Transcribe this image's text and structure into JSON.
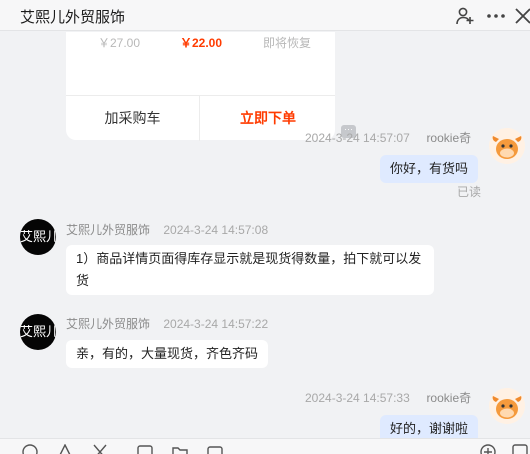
{
  "header": {
    "title": "艾熙儿外贸服饰"
  },
  "product_card": {
    "original_price": "￥27.00",
    "price": "￥22.00",
    "note": "即将恢复",
    "add_to_cart": "加采购车",
    "buy_now": "立即下单",
    "more_label": "···"
  },
  "messages": [
    {
      "time": "2024-3-24 14:57:07",
      "sender": "rookie奇",
      "text": "你好，有货吗",
      "status": "已读"
    },
    {
      "sender": "艾熙儿外贸服饰",
      "time": "2024-3-24 14:57:08",
      "text": "1）商品详情页面得库存显示就是现货得数量，拍下就可以发货",
      "avatar_text": "艾熙儿"
    },
    {
      "sender": "艾熙儿外贸服饰",
      "time": "2024-3-24 14:57:22",
      "text": "亲，有的，大量现货，齐色齐码",
      "avatar_text": "艾熙儿"
    },
    {
      "time": "2024-3-24 14:57:33",
      "sender": "rookie奇",
      "text": "好的，谢谢啦"
    }
  ],
  "icons": {
    "header": [
      "add-contact-icon",
      "more-icon",
      "close-icon"
    ],
    "toolbar": [
      "emoji-icon",
      "warning-icon",
      "scissors-icon",
      "image-icon",
      "folder-icon",
      "video-icon",
      "add-icon",
      "panel-icon"
    ]
  },
  "colors": {
    "accent": "#ff3b00",
    "outgoing_bubble": "#dfeaff",
    "background": "#f1f2f4"
  }
}
